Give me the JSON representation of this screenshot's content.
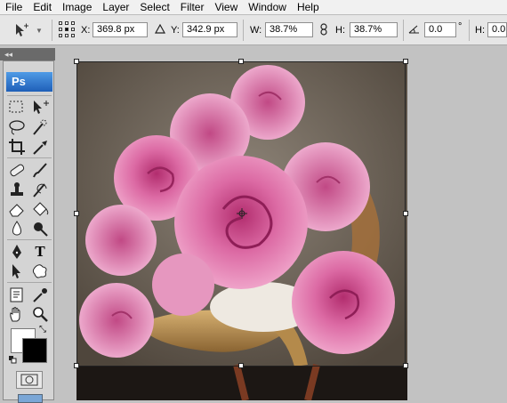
{
  "menu": [
    "File",
    "Edit",
    "Image",
    "Layer",
    "Select",
    "Filter",
    "View",
    "Window",
    "Help"
  ],
  "options": {
    "x_label": "X:",
    "x_value": "369.8 px",
    "y_label": "Y:",
    "y_value": "342.9 px",
    "w_label": "W:",
    "w_value": "38.7%",
    "h_label": "H:",
    "h_value": "38.7%",
    "rotate_value": "0.0",
    "rotate_unit": "°",
    "hskew_label": "H:",
    "hskew_value": "0.0"
  },
  "tools": {
    "collapse_glyph": "◂◂",
    "logo": "Ps",
    "type_tool_glyph": "T"
  },
  "colors": {
    "foreground": "#ffffff",
    "background": "#000000"
  }
}
